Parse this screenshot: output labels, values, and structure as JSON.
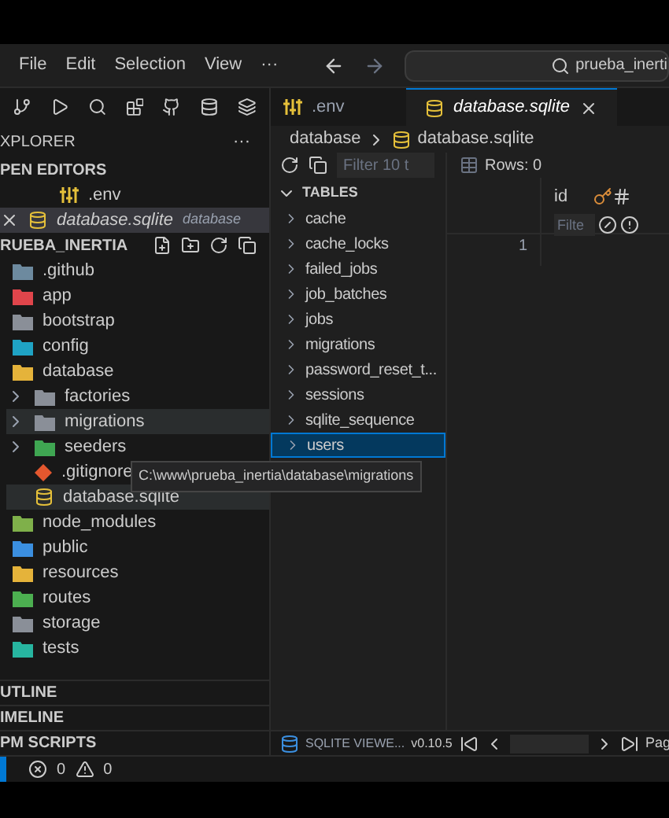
{
  "menu": [
    "File",
    "Edit",
    "Selection",
    "View",
    "···"
  ],
  "command_center": {
    "value": "prueba_inerti"
  },
  "explorer": {
    "title": "XPLORER",
    "more": "···",
    "open_editors": {
      "title": "PEN EDITORS",
      "items": [
        {
          "name": ".env",
          "selected": false,
          "kind": "env"
        },
        {
          "name": "database.sqlite",
          "description": "database",
          "selected": true,
          "kind": "db"
        }
      ]
    },
    "project": {
      "title": "RUEBA_INERTIA",
      "items": [
        {
          "name": ".github",
          "kind": "folder",
          "color": "#6d8a9f"
        },
        {
          "name": "app",
          "kind": "folder",
          "color": "#e0454b"
        },
        {
          "name": "bootstrap",
          "kind": "folder",
          "color": "#8a8f98"
        },
        {
          "name": "config",
          "kind": "folder",
          "color": "#1fa3c4"
        },
        {
          "name": "database",
          "kind": "folder",
          "color": "#e5b33a",
          "children": [
            {
              "name": "factories",
              "kind": "folder",
              "color": "#8a8f98",
              "expanded": false,
              "hovered": false
            },
            {
              "name": "migrations",
              "kind": "folder",
              "color": "#8a8f98",
              "expanded": false,
              "hovered": true
            },
            {
              "name": "seeders",
              "kind": "folder",
              "color": "#3fa652",
              "expanded": false,
              "hovered": false
            },
            {
              "name": ".gitignore",
              "kind": "git",
              "hovered": false
            },
            {
              "name": "database.sqlite",
              "kind": "db",
              "selected": true
            }
          ]
        },
        {
          "name": "node_modules",
          "kind": "folder",
          "color": "#7fb04a"
        },
        {
          "name": "public",
          "kind": "folder",
          "color": "#3b8fe0"
        },
        {
          "name": "resources",
          "kind": "folder",
          "color": "#e5b33a"
        },
        {
          "name": "routes",
          "kind": "folder",
          "color": "#4caf50"
        },
        {
          "name": "storage",
          "kind": "folder",
          "color": "#8a8f98"
        },
        {
          "name": "tests",
          "kind": "folder",
          "color": "#27b5a0"
        }
      ]
    },
    "tooltip": "C:\\www\\prueba_inertia\\database\\migrations",
    "sections": [
      "UTLINE",
      "IMELINE",
      "PM SCRIPTS"
    ]
  },
  "tabs": [
    {
      "label": ".env",
      "selected": false,
      "kind": "env"
    },
    {
      "label": "database.sqlite",
      "selected": true,
      "kind": "db"
    }
  ],
  "breadcrumb": [
    "database",
    "database.sqlite"
  ],
  "viewer": {
    "filter_placeholder": "Filter 10 t",
    "tables_title": "TABLES",
    "tables": [
      {
        "name": "cache",
        "selected": false
      },
      {
        "name": "cache_locks",
        "selected": false
      },
      {
        "name": "failed_jobs",
        "selected": false
      },
      {
        "name": "job_batches",
        "selected": false
      },
      {
        "name": "jobs",
        "selected": false
      },
      {
        "name": "migrations",
        "selected": false
      },
      {
        "name": "password_reset_t...",
        "selected": false
      },
      {
        "name": "sessions",
        "selected": false
      },
      {
        "name": "sqlite_sequence",
        "selected": false
      },
      {
        "name": "users",
        "selected": true
      }
    ],
    "rows_label": "Rows: 0",
    "column": "id",
    "column_filter_placeholder": "Filte",
    "row_number": "1",
    "footer": {
      "name": "SQLITE VIEWE...",
      "version": "v0.10.5",
      "page": "Pag"
    }
  },
  "status": {
    "errors": "0",
    "warnings": "0"
  }
}
